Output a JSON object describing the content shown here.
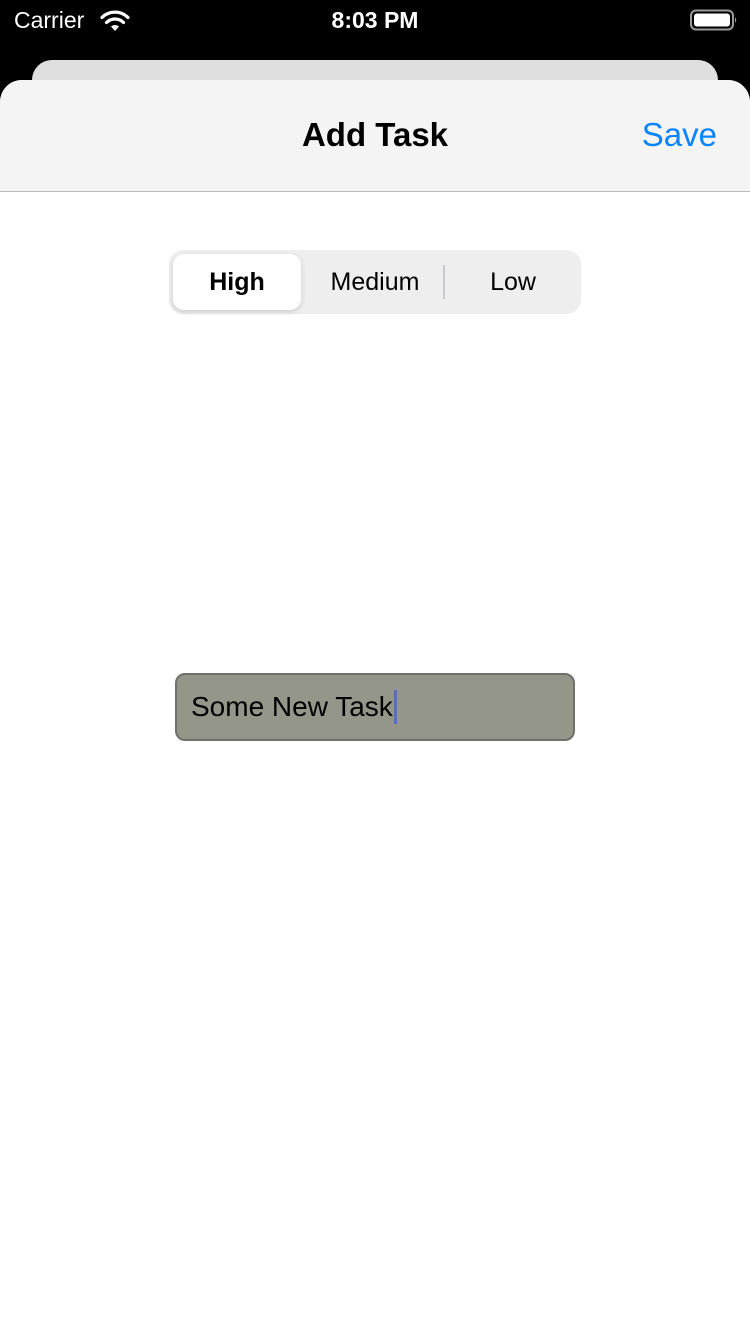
{
  "status_bar": {
    "carrier": "Carrier",
    "time": "8:03 PM",
    "wifi_icon": "wifi-icon",
    "battery_icon": "battery-icon"
  },
  "nav": {
    "title": "Add Task",
    "save_label": "Save",
    "accent_color": "#0a84ff"
  },
  "priority": {
    "options": [
      "High",
      "Medium",
      "Low"
    ],
    "selected": "High"
  },
  "task_field": {
    "value": "Some New Task",
    "background_color": "#94968a"
  }
}
